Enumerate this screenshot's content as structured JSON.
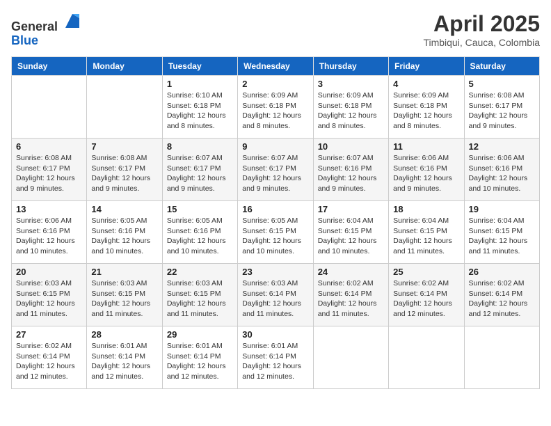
{
  "header": {
    "logo_line1": "General",
    "logo_line2": "Blue",
    "title": "April 2025",
    "subtitle": "Timbiqui, Cauca, Colombia"
  },
  "days_of_week": [
    "Sunday",
    "Monday",
    "Tuesday",
    "Wednesday",
    "Thursday",
    "Friday",
    "Saturday"
  ],
  "weeks": [
    [
      {
        "day": "",
        "info": ""
      },
      {
        "day": "",
        "info": ""
      },
      {
        "day": "1",
        "info": "Sunrise: 6:10 AM\nSunset: 6:18 PM\nDaylight: 12 hours and 8 minutes."
      },
      {
        "day": "2",
        "info": "Sunrise: 6:09 AM\nSunset: 6:18 PM\nDaylight: 12 hours and 8 minutes."
      },
      {
        "day": "3",
        "info": "Sunrise: 6:09 AM\nSunset: 6:18 PM\nDaylight: 12 hours and 8 minutes."
      },
      {
        "day": "4",
        "info": "Sunrise: 6:09 AM\nSunset: 6:18 PM\nDaylight: 12 hours and 8 minutes."
      },
      {
        "day": "5",
        "info": "Sunrise: 6:08 AM\nSunset: 6:17 PM\nDaylight: 12 hours and 9 minutes."
      }
    ],
    [
      {
        "day": "6",
        "info": "Sunrise: 6:08 AM\nSunset: 6:17 PM\nDaylight: 12 hours and 9 minutes."
      },
      {
        "day": "7",
        "info": "Sunrise: 6:08 AM\nSunset: 6:17 PM\nDaylight: 12 hours and 9 minutes."
      },
      {
        "day": "8",
        "info": "Sunrise: 6:07 AM\nSunset: 6:17 PM\nDaylight: 12 hours and 9 minutes."
      },
      {
        "day": "9",
        "info": "Sunrise: 6:07 AM\nSunset: 6:17 PM\nDaylight: 12 hours and 9 minutes."
      },
      {
        "day": "10",
        "info": "Sunrise: 6:07 AM\nSunset: 6:16 PM\nDaylight: 12 hours and 9 minutes."
      },
      {
        "day": "11",
        "info": "Sunrise: 6:06 AM\nSunset: 6:16 PM\nDaylight: 12 hours and 9 minutes."
      },
      {
        "day": "12",
        "info": "Sunrise: 6:06 AM\nSunset: 6:16 PM\nDaylight: 12 hours and 10 minutes."
      }
    ],
    [
      {
        "day": "13",
        "info": "Sunrise: 6:06 AM\nSunset: 6:16 PM\nDaylight: 12 hours and 10 minutes."
      },
      {
        "day": "14",
        "info": "Sunrise: 6:05 AM\nSunset: 6:16 PM\nDaylight: 12 hours and 10 minutes."
      },
      {
        "day": "15",
        "info": "Sunrise: 6:05 AM\nSunset: 6:16 PM\nDaylight: 12 hours and 10 minutes."
      },
      {
        "day": "16",
        "info": "Sunrise: 6:05 AM\nSunset: 6:15 PM\nDaylight: 12 hours and 10 minutes."
      },
      {
        "day": "17",
        "info": "Sunrise: 6:04 AM\nSunset: 6:15 PM\nDaylight: 12 hours and 10 minutes."
      },
      {
        "day": "18",
        "info": "Sunrise: 6:04 AM\nSunset: 6:15 PM\nDaylight: 12 hours and 11 minutes."
      },
      {
        "day": "19",
        "info": "Sunrise: 6:04 AM\nSunset: 6:15 PM\nDaylight: 12 hours and 11 minutes."
      }
    ],
    [
      {
        "day": "20",
        "info": "Sunrise: 6:03 AM\nSunset: 6:15 PM\nDaylight: 12 hours and 11 minutes."
      },
      {
        "day": "21",
        "info": "Sunrise: 6:03 AM\nSunset: 6:15 PM\nDaylight: 12 hours and 11 minutes."
      },
      {
        "day": "22",
        "info": "Sunrise: 6:03 AM\nSunset: 6:15 PM\nDaylight: 12 hours and 11 minutes."
      },
      {
        "day": "23",
        "info": "Sunrise: 6:03 AM\nSunset: 6:14 PM\nDaylight: 12 hours and 11 minutes."
      },
      {
        "day": "24",
        "info": "Sunrise: 6:02 AM\nSunset: 6:14 PM\nDaylight: 12 hours and 11 minutes."
      },
      {
        "day": "25",
        "info": "Sunrise: 6:02 AM\nSunset: 6:14 PM\nDaylight: 12 hours and 12 minutes."
      },
      {
        "day": "26",
        "info": "Sunrise: 6:02 AM\nSunset: 6:14 PM\nDaylight: 12 hours and 12 minutes."
      }
    ],
    [
      {
        "day": "27",
        "info": "Sunrise: 6:02 AM\nSunset: 6:14 PM\nDaylight: 12 hours and 12 minutes."
      },
      {
        "day": "28",
        "info": "Sunrise: 6:01 AM\nSunset: 6:14 PM\nDaylight: 12 hours and 12 minutes."
      },
      {
        "day": "29",
        "info": "Sunrise: 6:01 AM\nSunset: 6:14 PM\nDaylight: 12 hours and 12 minutes."
      },
      {
        "day": "30",
        "info": "Sunrise: 6:01 AM\nSunset: 6:14 PM\nDaylight: 12 hours and 12 minutes."
      },
      {
        "day": "",
        "info": ""
      },
      {
        "day": "",
        "info": ""
      },
      {
        "day": "",
        "info": ""
      }
    ]
  ]
}
